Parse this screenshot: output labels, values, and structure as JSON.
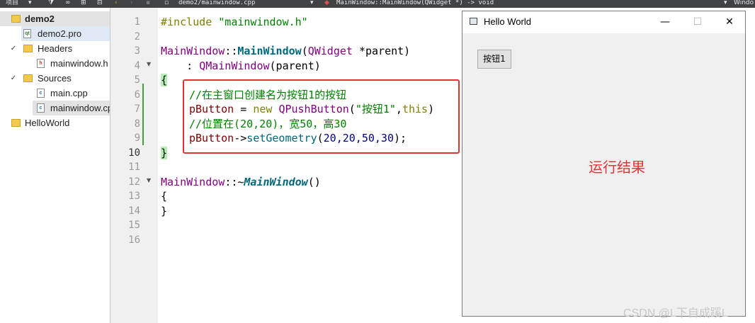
{
  "toolbar": {
    "project_label": "项目",
    "file_path": "demo2/mainwindow.cpp",
    "function_signature": "MainWindow::MainWindow(QWidget *) -> void",
    "right_label": "Windo"
  },
  "sidebar": {
    "items": [
      {
        "label": "demo2"
      },
      {
        "label": "demo2.pro"
      },
      {
        "label": "Headers"
      },
      {
        "label": "mainwindow.h"
      },
      {
        "label": "Sources"
      },
      {
        "label": "main.cpp"
      },
      {
        "label": "mainwindow.cpp"
      },
      {
        "label": "HelloWorld"
      }
    ]
  },
  "editor": {
    "line_numbers": [
      "1",
      "2",
      "3",
      "4",
      "5",
      "6",
      "7",
      "8",
      "9",
      "10",
      "11",
      "12",
      "13",
      "14",
      "15",
      "16"
    ],
    "current_line": "10",
    "lines": {
      "l1_directive": "#include ",
      "l1_string": "\"mainwindow.h\"",
      "l3_class": "MainWindow",
      "l3_sep": "::",
      "l3_ctor": "MainWindow",
      "l3_paren": "(",
      "l3_type": "QWidget",
      "l3_param": " *parent)",
      "l4_colon": "    : ",
      "l4_base": "QMainWindow",
      "l4_rest": "(parent)",
      "l5_brace": "{",
      "l6_comment": "//在主窗口创建名为按钮1的按钮",
      "l7_var": "pButton",
      "l7_eq": " = ",
      "l7_new": "new",
      "l7_sp": " ",
      "l7_cls": "QPushButton",
      "l7_open": "(",
      "l7_str": "\"按钮1\"",
      "l7_comma": ",",
      "l7_this": "this",
      "l7_close": ")",
      "l8_comment": "//位置在(20,20)，宽50，高30",
      "l9_var": "pButton",
      "l9_arrow": "->",
      "l9_method": "setGeometry",
      "l9_open": "(",
      "l9_args": "20,20,50,30",
      "l9_close": ");",
      "l10_brace": "}",
      "l12_class": "MainWindow",
      "l12_sep": "::~",
      "l12_dtor": "MainWindow",
      "l12_paren": "()",
      "l13_brace": "{",
      "l14_brace": "}"
    }
  },
  "window": {
    "title": "Hello World",
    "minimize": "—",
    "maximize": "☐",
    "close": "✕",
    "button_label": "按钮1"
  },
  "annotation": "运行结果",
  "watermark": "CSDN @L下自成蹊L",
  "colors": {
    "highlight_box": "#e53333",
    "topbar": "#404244",
    "gutter": "#f0f0f0"
  }
}
